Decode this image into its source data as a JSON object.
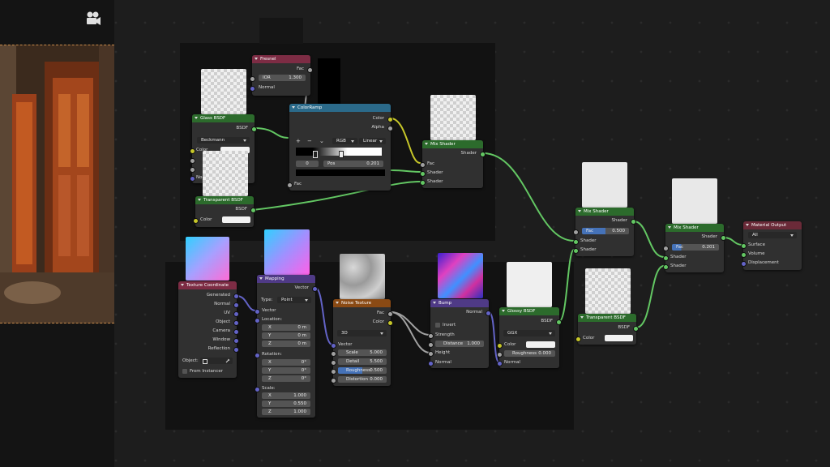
{
  "nodes": {
    "fresnel": {
      "title": "Fresnel",
      "out_fac": "Fac",
      "ior_label": "IOR",
      "ior_value": "1.300",
      "in_normal": "Normal"
    },
    "colorramp": {
      "title": "ColorRamp",
      "out_color": "Color",
      "out_alpha": "Alpha",
      "add": "+",
      "remove": "−",
      "chevron": "⌄",
      "mode": "RGB",
      "interp": "Linear",
      "index": "0",
      "pos_label": "Pos",
      "pos_value": "0.201",
      "in_fac": "Fac"
    },
    "glass": {
      "title": "Glass BSDF",
      "out": "BSDF",
      "distribution": "Beckmann",
      "in_color": "Color",
      "in_normal": "Normal"
    },
    "transparent1": {
      "title": "Transparent BSDF",
      "out": "BSDF",
      "in_color": "Color"
    },
    "mix1": {
      "title": "Mix Shader",
      "out": "Shader",
      "in_fac": "Fac",
      "in_s1": "Shader",
      "in_s2": "Shader"
    },
    "mix2": {
      "title": "Mix Shader",
      "out": "Shader",
      "fac_label": "Fac",
      "fac_value": "0.500",
      "in_s1": "Shader",
      "in_s2": "Shader"
    },
    "mix3": {
      "title": "Mix Shader",
      "out": "Shader",
      "fac_label": "Fac",
      "fac_value": "0.201",
      "in_s1": "Shader",
      "in_s2": "Shader"
    },
    "matout": {
      "title": "Material Output",
      "target": "All",
      "in_surface": "Surface",
      "in_volume": "Volume",
      "in_displacement": "Displacement"
    },
    "texcoord": {
      "title": "Texture Coordinate",
      "outputs": [
        "Generated",
        "Normal",
        "UV",
        "Object",
        "Camera",
        "Window",
        "Reflection"
      ],
      "object_label": "Object:",
      "from_instancer": "From Instancer"
    },
    "mapping": {
      "title": "Mapping",
      "out_vector": "Vector",
      "type_label": "Type:",
      "type_value": "Point",
      "in_vector": "Vector",
      "location_label": "Location:",
      "loc": [
        {
          "axis": "X",
          "value": "0 m"
        },
        {
          "axis": "Y",
          "value": "0 m"
        },
        {
          "axis": "Z",
          "value": "0 m"
        }
      ],
      "rotation_label": "Rotation:",
      "rot": [
        {
          "axis": "X",
          "value": "0°"
        },
        {
          "axis": "Y",
          "value": "0°"
        },
        {
          "axis": "Z",
          "value": "0°"
        }
      ],
      "scale_label": "Scale:",
      "scale": [
        {
          "axis": "X",
          "value": "1.000"
        },
        {
          "axis": "Y",
          "value": "0.550"
        },
        {
          "axis": "Z",
          "value": "1.000"
        }
      ]
    },
    "noise": {
      "title": "Noise Texture",
      "out_fac": "Fac",
      "out_color": "Color",
      "dimensions": "3D",
      "in_vector": "Vector",
      "params": [
        {
          "label": "Scale",
          "value": "5.000"
        },
        {
          "label": "Detail",
          "value": "5.500"
        },
        {
          "label": "Roughness",
          "value": "0.500"
        },
        {
          "label": "Distortion",
          "value": "0.000"
        }
      ]
    },
    "bump": {
      "title": "Bump",
      "out_normal": "Normal",
      "invert": "Invert",
      "in_strength": "Strength",
      "distance_label": "Distance",
      "distance_value": "1.000",
      "in_height": "Height",
      "in_normal": "Normal"
    },
    "glossy": {
      "title": "Glossy BSDF",
      "out": "BSDF",
      "distribution": "GGX",
      "in_color": "Color",
      "roughness_label": "Roughness",
      "roughness_value": "0.000",
      "in_normal": "Normal"
    },
    "transparent2": {
      "title": "Transparent BSDF",
      "out": "BSDF",
      "in_color": "Color"
    }
  },
  "colors": {
    "shader_header": "#2c6b2c",
    "input_header": "#7d2c44",
    "converter_header": "#2b6a8a",
    "vector_header": "#4f3a86",
    "texture_header": "#8a4a14",
    "shader_wire": "#63c763",
    "vector_wire": "#6363c7",
    "color_wire": "#c7c729",
    "float_wire": "#a1a1a1"
  },
  "icons": {
    "camera": "movie-camera-icon",
    "eyedropper": "eyedropper-icon"
  }
}
